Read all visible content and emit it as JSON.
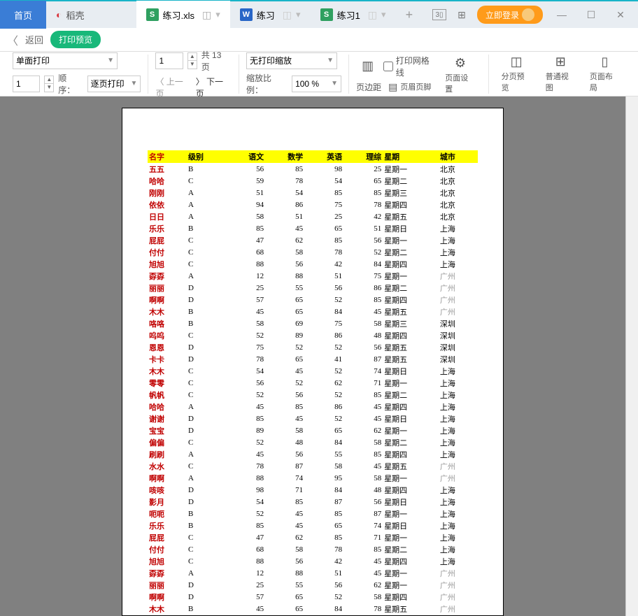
{
  "titlebar": {
    "home": "首页",
    "dao": "稻壳",
    "tab1": "练习.xls",
    "tab2": "练习",
    "tab3": "练习1",
    "login": "立即登录"
  },
  "navbar": {
    "back": "返回",
    "preview": "打印预览"
  },
  "toolbar": {
    "print_mode": "单面打印",
    "copies": "1",
    "order_label": "顺序：",
    "order_value": "逐页打印",
    "page_current": "1",
    "page_total_prefix": "共",
    "page_total": "13",
    "page_total_suffix": "页",
    "prev_page": "上一页",
    "next_page": "下一页",
    "zoom_mode": "无打印缩放",
    "zoom_ratio_label": "缩放比例：",
    "zoom_ratio": "100 %",
    "margin": "页边距",
    "gridlines": "打印网格线",
    "header_footer": "页眉页脚",
    "page_setup": "页面设置",
    "page_break": "分页预览",
    "normal_view": "普通视图",
    "page_layout": "页面布局"
  },
  "table": {
    "headers": [
      "名字",
      "级别",
      "语文",
      "数学",
      "英语",
      "理综",
      "星期",
      "城市"
    ],
    "rows": [
      [
        "五五",
        "B",
        "56",
        "85",
        "98",
        "25",
        "星期一",
        "北京",
        false
      ],
      [
        "哈哈",
        "C",
        "59",
        "78",
        "54",
        "65",
        "星期二",
        "北京",
        false
      ],
      [
        "刚刚",
        "A",
        "51",
        "54",
        "85",
        "85",
        "星期三",
        "北京",
        false
      ],
      [
        "依依",
        "A",
        "94",
        "86",
        "75",
        "78",
        "星期四",
        "北京",
        false
      ],
      [
        "日日",
        "A",
        "58",
        "51",
        "25",
        "42",
        "星期五",
        "北京",
        false
      ],
      [
        "乐乐",
        "B",
        "85",
        "45",
        "65",
        "51",
        "星期日",
        "上海",
        false
      ],
      [
        "屁屁",
        "C",
        "47",
        "62",
        "85",
        "56",
        "星期一",
        "上海",
        false
      ],
      [
        "付付",
        "C",
        "68",
        "58",
        "78",
        "52",
        "星期二",
        "上海",
        false
      ],
      [
        "旭旭",
        "C",
        "88",
        "56",
        "42",
        "84",
        "星期四",
        "上海",
        false
      ],
      [
        "孬孬",
        "A",
        "12",
        "88",
        "51",
        "75",
        "星期一",
        "广州",
        true
      ],
      [
        "丽丽",
        "D",
        "25",
        "55",
        "56",
        "86",
        "星期二",
        "广州",
        true
      ],
      [
        "啊啊",
        "D",
        "57",
        "65",
        "52",
        "85",
        "星期四",
        "广州",
        true
      ],
      [
        "木木",
        "B",
        "45",
        "65",
        "84",
        "45",
        "星期五",
        "广州",
        true
      ],
      [
        "咯咯",
        "B",
        "58",
        "69",
        "75",
        "58",
        "星期三",
        "深圳",
        false
      ],
      [
        "呜呜",
        "C",
        "52",
        "89",
        "86",
        "48",
        "星期四",
        "深圳",
        false
      ],
      [
        "恩恩",
        "D",
        "75",
        "52",
        "52",
        "56",
        "星期五",
        "深圳",
        false
      ],
      [
        "卡卡",
        "D",
        "78",
        "65",
        "41",
        "87",
        "星期五",
        "深圳",
        false
      ],
      [
        "木木",
        "C",
        "54",
        "45",
        "52",
        "74",
        "星期日",
        "上海",
        false
      ],
      [
        "零零",
        "C",
        "56",
        "52",
        "62",
        "71",
        "星期一",
        "上海",
        false
      ],
      [
        "帆帆",
        "C",
        "52",
        "56",
        "52",
        "85",
        "星期二",
        "上海",
        false
      ],
      [
        "哈哈",
        "A",
        "45",
        "85",
        "86",
        "45",
        "星期四",
        "上海",
        false
      ],
      [
        "谢谢",
        "D",
        "85",
        "45",
        "52",
        "45",
        "星期日",
        "上海",
        false
      ],
      [
        "宝宝",
        "D",
        "89",
        "58",
        "65",
        "62",
        "星期一",
        "上海",
        false
      ],
      [
        "偏偏",
        "C",
        "52",
        "48",
        "84",
        "58",
        "星期二",
        "上海",
        false
      ],
      [
        "刷刷",
        "A",
        "45",
        "56",
        "55",
        "85",
        "星期四",
        "上海",
        false
      ],
      [
        "水水",
        "C",
        "78",
        "87",
        "58",
        "45",
        "星期五",
        "广州",
        true
      ],
      [
        "啊啊",
        "A",
        "88",
        "74",
        "95",
        "58",
        "星期一",
        "广州",
        true
      ],
      [
        "咳咳",
        "D",
        "98",
        "71",
        "84",
        "48",
        "星期四",
        "上海",
        false
      ],
      [
        "影月",
        "D",
        "54",
        "85",
        "87",
        "56",
        "星期日",
        "上海",
        false
      ],
      [
        "呃呃",
        "B",
        "52",
        "45",
        "85",
        "87",
        "星期一",
        "上海",
        false
      ],
      [
        "乐乐",
        "B",
        "85",
        "45",
        "65",
        "74",
        "星期日",
        "上海",
        false
      ],
      [
        "屁屁",
        "C",
        "47",
        "62",
        "85",
        "71",
        "星期一",
        "上海",
        false
      ],
      [
        "付付",
        "C",
        "68",
        "58",
        "78",
        "85",
        "星期二",
        "上海",
        false
      ],
      [
        "旭旭",
        "C",
        "88",
        "56",
        "42",
        "45",
        "星期四",
        "上海",
        false
      ],
      [
        "孬孬",
        "A",
        "12",
        "88",
        "51",
        "45",
        "星期一",
        "广州",
        true
      ],
      [
        "丽丽",
        "D",
        "25",
        "55",
        "56",
        "62",
        "星期一",
        "广州",
        true
      ],
      [
        "啊啊",
        "D",
        "57",
        "65",
        "52",
        "58",
        "星期四",
        "广州",
        true
      ],
      [
        "木木",
        "B",
        "45",
        "65",
        "84",
        "78",
        "星期五",
        "广州",
        true
      ]
    ]
  }
}
